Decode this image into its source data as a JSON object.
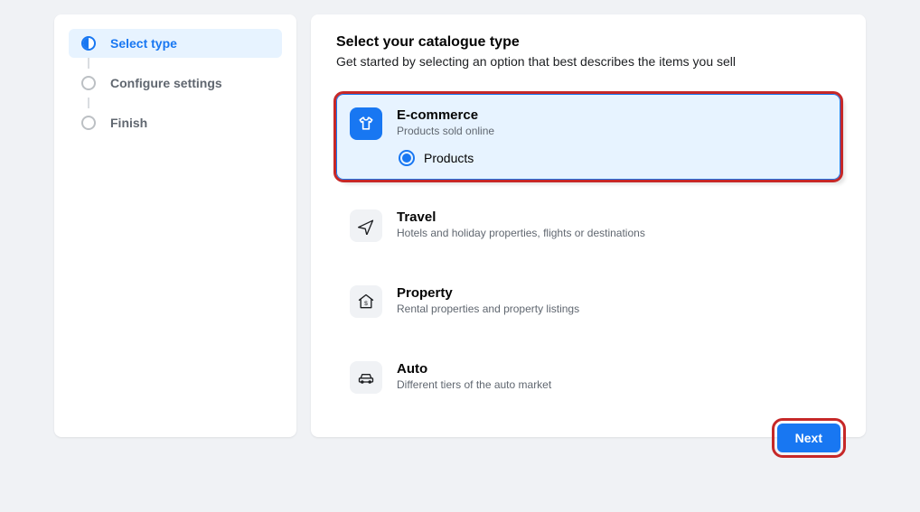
{
  "steps": {
    "select_type": "Select type",
    "configure_settings": "Configure settings",
    "finish": "Finish"
  },
  "main": {
    "title": "Select your catalogue type",
    "subtitle": "Get started by selecting an option that best describes the items you sell"
  },
  "options": {
    "ecommerce": {
      "title": "E-commerce",
      "desc": "Products sold online",
      "sub": "Products"
    },
    "travel": {
      "title": "Travel",
      "desc": "Hotels and holiday properties, flights or destinations"
    },
    "property": {
      "title": "Property",
      "desc": "Rental properties and property listings"
    },
    "auto": {
      "title": "Auto",
      "desc": "Different tiers of the auto market"
    }
  },
  "actions": {
    "next": "Next"
  }
}
